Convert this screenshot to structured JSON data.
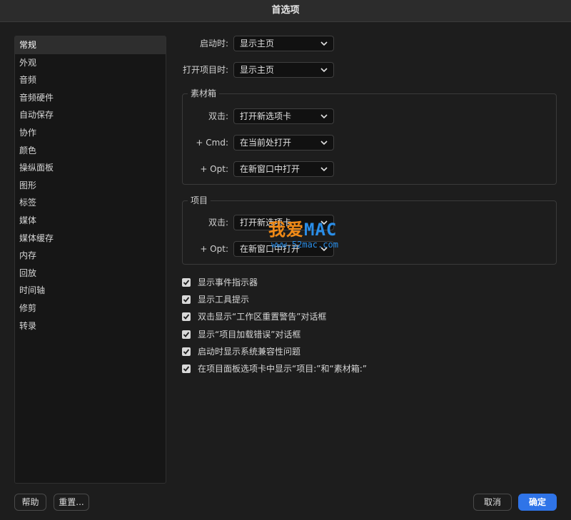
{
  "window": {
    "title": "首选项"
  },
  "sidebar": {
    "items": [
      {
        "label": "常规"
      },
      {
        "label": "外观"
      },
      {
        "label": "音频"
      },
      {
        "label": "音频硬件"
      },
      {
        "label": "自动保存"
      },
      {
        "label": "协作"
      },
      {
        "label": "颜色"
      },
      {
        "label": "操纵面板"
      },
      {
        "label": "图形"
      },
      {
        "label": "标签"
      },
      {
        "label": "媒体"
      },
      {
        "label": "媒体缓存"
      },
      {
        "label": "内存"
      },
      {
        "label": "回放"
      },
      {
        "label": "时间轴"
      },
      {
        "label": "修剪"
      },
      {
        "label": "转录"
      }
    ],
    "selected": "常规"
  },
  "general": {
    "startup": {
      "label": "启动时:",
      "value": "显示主页"
    },
    "open_project": {
      "label": "打开项目时:",
      "value": "显示主页"
    }
  },
  "bins": {
    "title": "素材箱",
    "double_click": {
      "label": "双击:",
      "value": "打开新选项卡"
    },
    "cmd": {
      "label": "+ Cmd:",
      "value": "在当前处打开"
    },
    "opt": {
      "label": "+ Opt:",
      "value": "在新窗口中打开"
    }
  },
  "project": {
    "title": "项目",
    "double_click": {
      "label": "双击:",
      "value": "打开新选项卡"
    },
    "opt": {
      "label": "+ Opt:",
      "value": "在新窗口中打开"
    }
  },
  "checkboxes": [
    {
      "label": "显示事件指示器",
      "checked": true
    },
    {
      "label": "显示工具提示",
      "checked": true
    },
    {
      "label": "双击显示“工作区重置警告”对话框",
      "checked": true
    },
    {
      "label": "显示“项目加载错误”对话框",
      "checked": true
    },
    {
      "label": "启动时显示系统兼容性问题",
      "checked": true
    },
    {
      "label": "在项目面板选项卡中显示“项目:”和“素材箱:”",
      "checked": true
    }
  ],
  "footer": {
    "help": "帮助",
    "reset": "重置...",
    "cancel": "取消",
    "ok": "确定"
  },
  "watermark": {
    "brand_cn": "我爱",
    "brand_mac": "MAC",
    "url": "www.52mac.com"
  },
  "colors": {
    "accent": "#2f74e8",
    "watermark_orange": "#f08a17",
    "watermark_blue": "#2a8ee8"
  }
}
